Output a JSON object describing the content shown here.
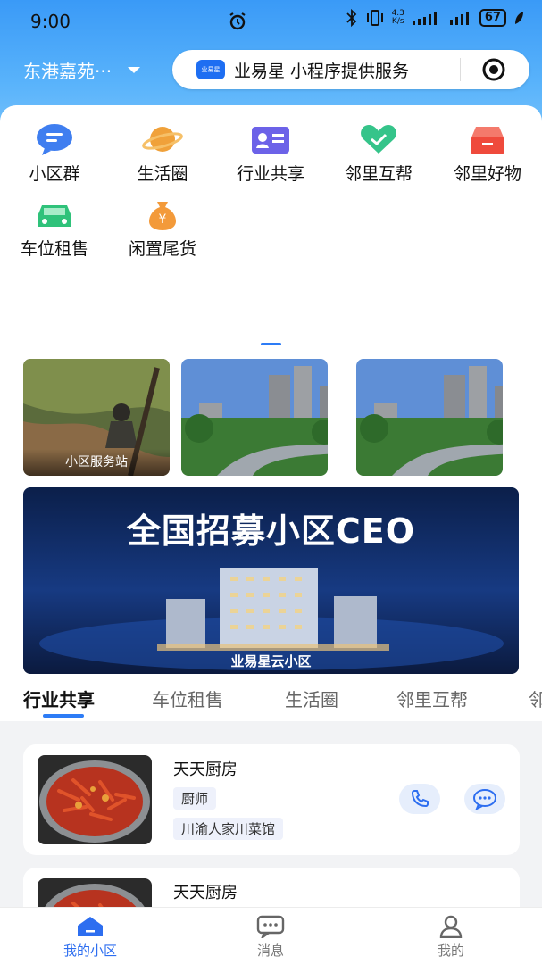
{
  "status_bar": {
    "time": "9:00",
    "net_speed_value": "4.3",
    "net_speed_unit": "K/s",
    "battery": "67"
  },
  "header": {
    "community_name": "东港嘉苑···",
    "capsule_logo": "业易星",
    "capsule_text": "业易星 小程序提供服务"
  },
  "menu": [
    {
      "label": "小区群",
      "icon": "chat-bubble-icon",
      "color": "#3f7ef0"
    },
    {
      "label": "生活圈",
      "icon": "planet-icon",
      "color": "#f0a13a"
    },
    {
      "label": "行业共享",
      "icon": "id-card-icon",
      "color": "#6c62e8"
    },
    {
      "label": "邻里互帮",
      "icon": "heart-hand-icon",
      "color": "#35c48a"
    },
    {
      "label": "邻里好物",
      "icon": "box-icon",
      "color": "#ef4a3c"
    },
    {
      "label": "车位租售",
      "icon": "car-icon",
      "color": "#2fc27a"
    },
    {
      "label": "闲置尾货",
      "icon": "money-bag-icon",
      "color": "#f39a3a"
    }
  ],
  "photos": [
    {
      "caption": "小区服务站"
    },
    {
      "caption": ""
    },
    {
      "caption": ""
    }
  ],
  "banner": {
    "title": "全国招募小区CEO",
    "subtitle": "业易星云小区"
  },
  "tabs": [
    {
      "label": "行业共享",
      "active": true
    },
    {
      "label": "车位租售",
      "active": false
    },
    {
      "label": "生活圈",
      "active": false
    },
    {
      "label": "邻里互帮",
      "active": false
    },
    {
      "label": "邻",
      "active": false
    }
  ],
  "listings": [
    {
      "title": "天天厨房",
      "role": "厨师",
      "shop": "川渝人家川菜馆"
    },
    {
      "title": "天天厨房"
    }
  ],
  "bottom_nav": [
    {
      "label": "我的小区",
      "icon": "home-icon",
      "active": true
    },
    {
      "label": "消息",
      "icon": "message-icon",
      "active": false
    },
    {
      "label": "我的",
      "icon": "person-icon",
      "active": false
    }
  ],
  "colors": {
    "accent": "#2d7cf6",
    "header_gradient_top": "#3a9af7",
    "header_gradient_bottom": "#7ec6fb"
  }
}
